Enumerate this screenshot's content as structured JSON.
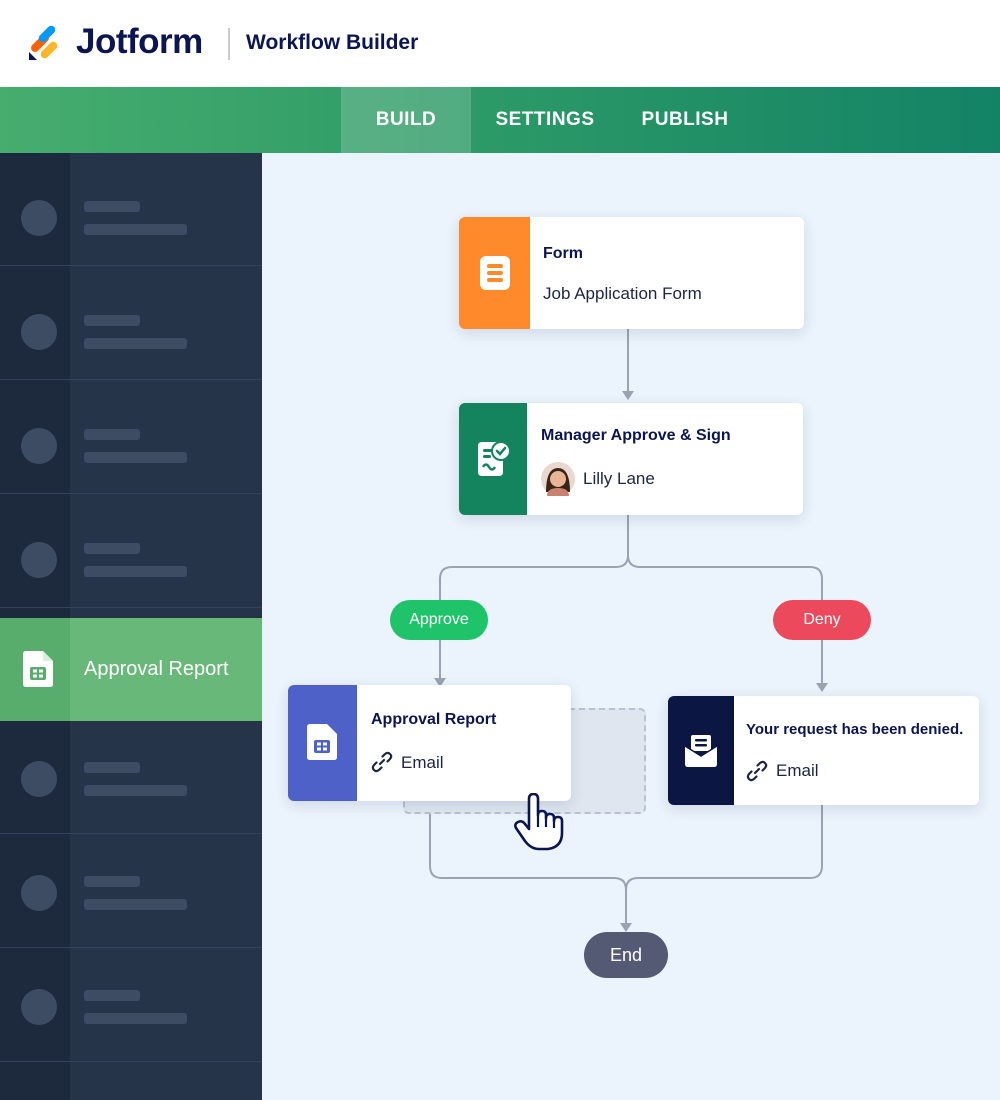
{
  "header": {
    "brand": "Jotform",
    "app_title": "Workflow Builder"
  },
  "tabs": [
    {
      "label": "BUILD",
      "active": true
    },
    {
      "label": "SETTINGS",
      "active": false
    },
    {
      "label": "PUBLISH",
      "active": false
    }
  ],
  "sidebar": {
    "active_item_label": "Approval Report"
  },
  "workflow": {
    "form_node": {
      "title": "Form",
      "subtitle": "Job Application Form"
    },
    "approval_node": {
      "title": "Manager Approve & Sign",
      "assignee": "Lilly Lane"
    },
    "branch_approve": {
      "label": "Approve"
    },
    "branch_deny": {
      "label": "Deny"
    },
    "report_node": {
      "title": "Approval Report",
      "action": "Email"
    },
    "denied_node": {
      "title": "Your request has been denied.",
      "action": "Email"
    },
    "end": {
      "label": "End"
    }
  },
  "colors": {
    "brand_navy": "#0a1551",
    "form_orange": "#ff8a2b",
    "approval_green": "#14845e",
    "report_blue": "#4e61c9",
    "denied_navy": "#0b1742",
    "approve_green": "#1fc36a",
    "deny_red": "#ec4a5c"
  },
  "icons": [
    "jotform-logo-icon",
    "form-document-icon",
    "checklist-sign-icon",
    "report-sheet-icon",
    "link-icon",
    "envelope-icon",
    "hand-pointer-icon"
  ]
}
